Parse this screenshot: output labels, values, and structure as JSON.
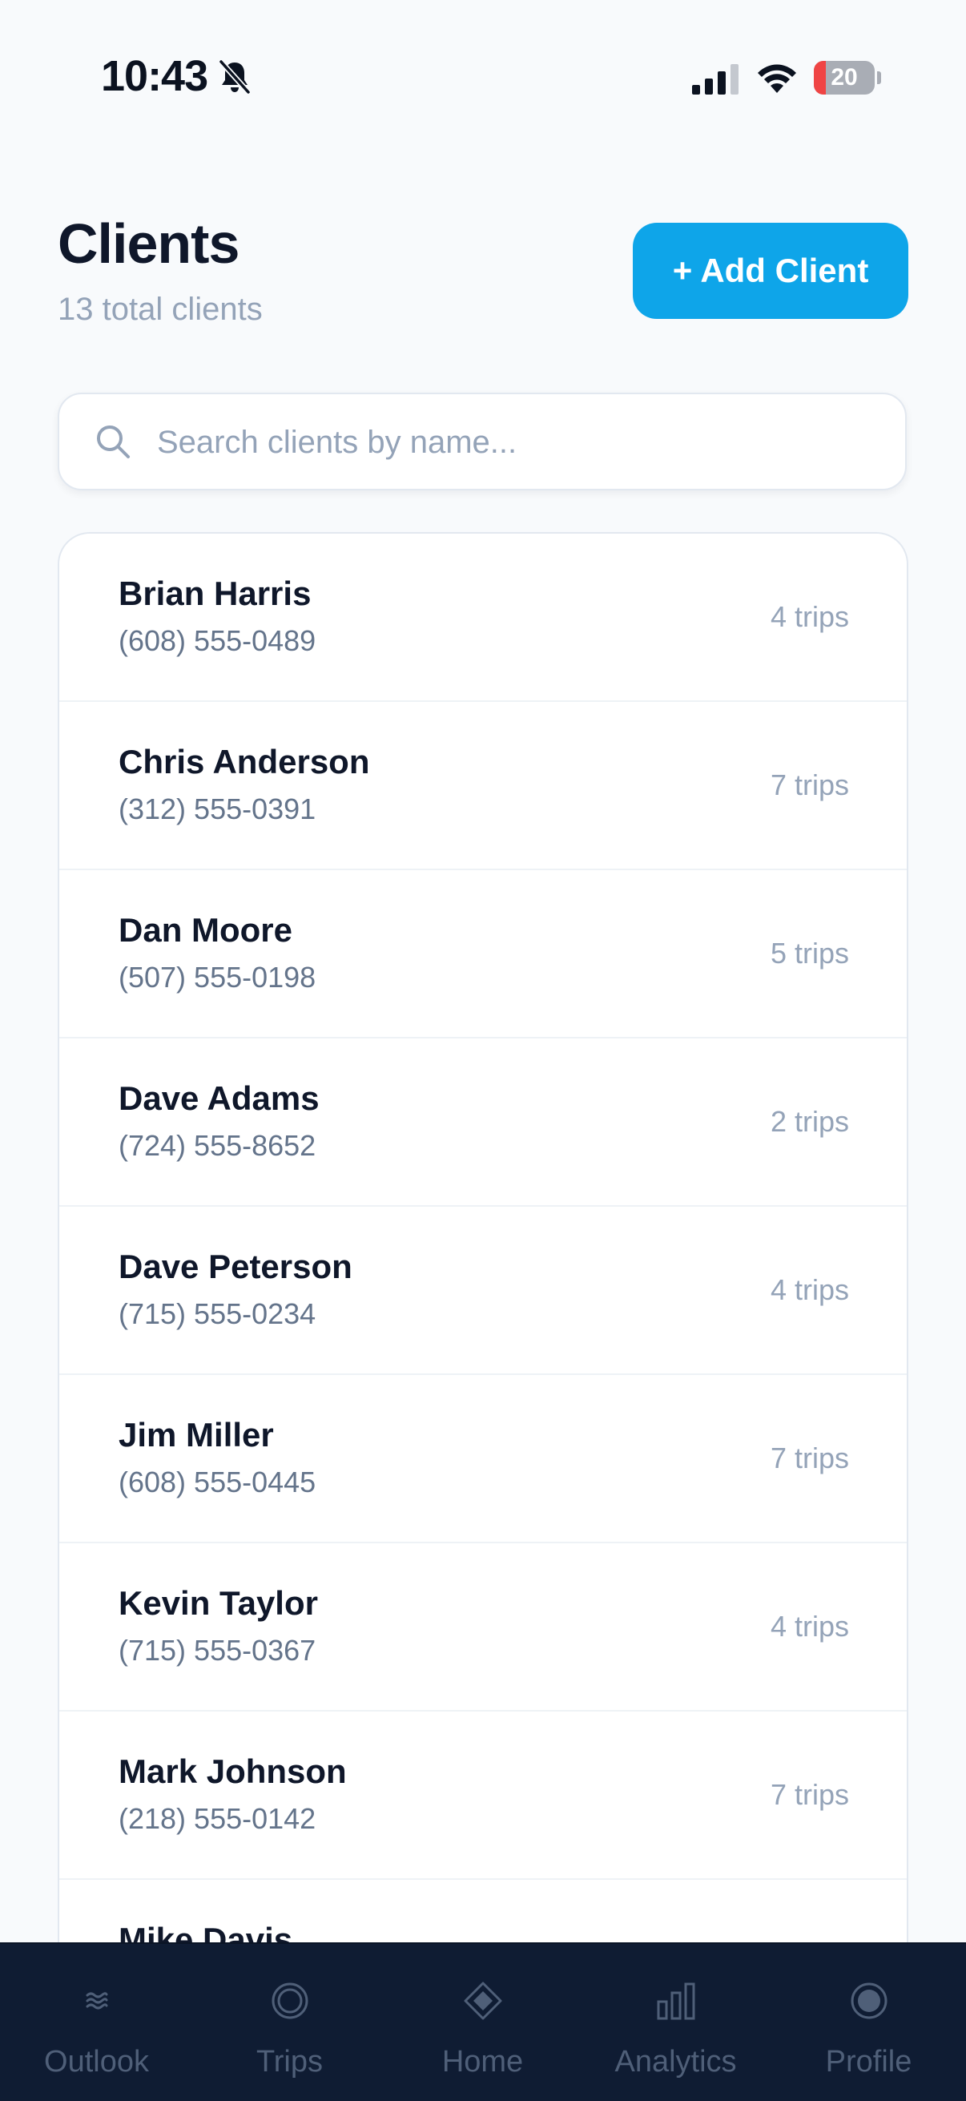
{
  "status_bar": {
    "time": "10:43",
    "battery_level": "20",
    "battery_color": "#ef4444"
  },
  "header": {
    "title": "Clients",
    "subtitle": "13 total clients",
    "add_button_label": "+ Add Client"
  },
  "search": {
    "placeholder": "Search clients by name...",
    "value": ""
  },
  "clients": [
    {
      "name": "Brian Harris",
      "phone": "(608) 555-0489",
      "trips": "4 trips"
    },
    {
      "name": "Chris Anderson",
      "phone": "(312) 555-0391",
      "trips": "7 trips"
    },
    {
      "name": "Dan Moore",
      "phone": "(507) 555-0198",
      "trips": "5 trips"
    },
    {
      "name": "Dave Adams",
      "phone": "(724) 555-8652",
      "trips": "2 trips"
    },
    {
      "name": "Dave Peterson",
      "phone": "(715) 555-0234",
      "trips": "4 trips"
    },
    {
      "name": "Jim Miller",
      "phone": "(608) 555-0445",
      "trips": "7 trips"
    },
    {
      "name": "Kevin Taylor",
      "phone": "(715) 555-0367",
      "trips": "4 trips"
    },
    {
      "name": "Mark Johnson",
      "phone": "(218) 555-0142",
      "trips": "7 trips"
    },
    {
      "name": "Mike Davis",
      "phone": "",
      "trips": ""
    }
  ],
  "tab_bar": {
    "tabs": [
      {
        "label": "Outlook",
        "icon": "waves-icon"
      },
      {
        "label": "Trips",
        "icon": "target-icon"
      },
      {
        "label": "Home",
        "icon": "diamond-icon"
      },
      {
        "label": "Analytics",
        "icon": "bar-chart-icon"
      },
      {
        "label": "Profile",
        "icon": "profile-dot-icon"
      }
    ]
  },
  "colors": {
    "accent": "#0ea5e9",
    "tab_bar_background": "#0f1c33",
    "tab_inactive": "#4f5f78"
  }
}
